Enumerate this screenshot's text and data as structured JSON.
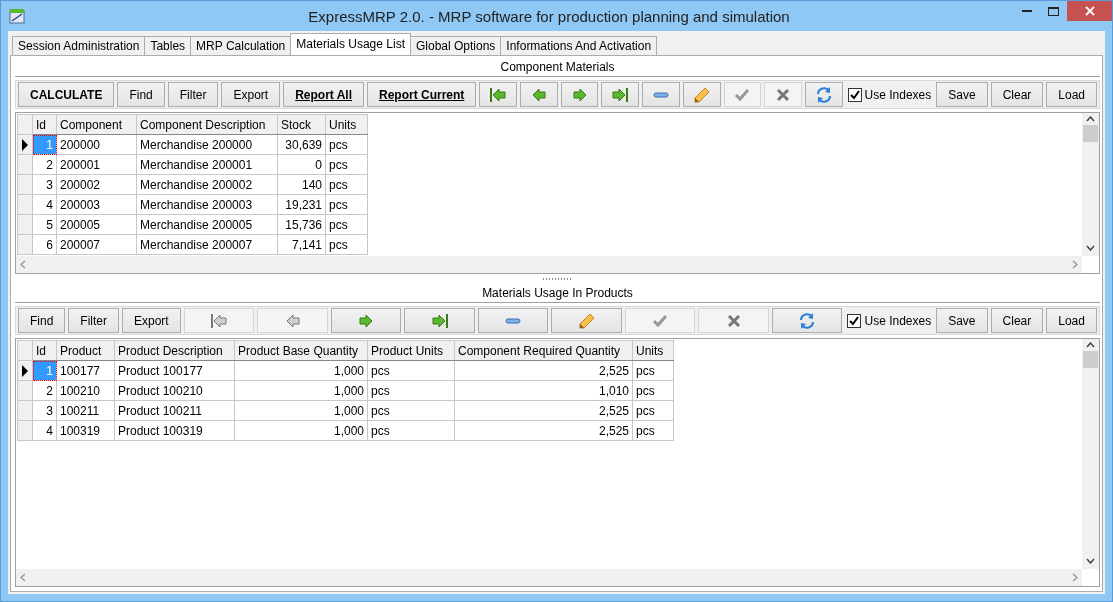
{
  "window": {
    "title": "ExpressMRP 2.0. - MRP software for production planning and simulation"
  },
  "tabs": [
    {
      "label": "Session Administration",
      "selected": false
    },
    {
      "label": "Tables",
      "selected": false
    },
    {
      "label": "MRP Calculation",
      "selected": false
    },
    {
      "label": "Materials Usage List",
      "selected": true
    },
    {
      "label": "Global Options",
      "selected": false
    },
    {
      "label": "Informations And Activation",
      "selected": false
    }
  ],
  "panels": [
    {
      "caption": "Component Materials",
      "toolbar": [
        {
          "kind": "strong",
          "label": "CALCULATE"
        },
        {
          "kind": "button",
          "label": "Find"
        },
        {
          "kind": "button",
          "label": "Filter"
        },
        {
          "kind": "button",
          "label": "Export"
        },
        {
          "kind": "link",
          "label": "Report All"
        },
        {
          "kind": "link",
          "label": "Report Current"
        },
        {
          "kind": "first",
          "disabled": false
        },
        {
          "kind": "prev",
          "disabled": false
        },
        {
          "kind": "next",
          "disabled": false
        },
        {
          "kind": "last",
          "disabled": false
        },
        {
          "kind": "delete",
          "disabled": false
        },
        {
          "kind": "edit",
          "disabled": false
        },
        {
          "kind": "post",
          "disabled": true
        },
        {
          "kind": "cancel",
          "disabled": true
        },
        {
          "kind": "refresh",
          "disabled": false
        },
        {
          "kind": "checkbox",
          "label": "Use Indexes",
          "checked": true
        },
        {
          "kind": "button",
          "label": "Save"
        },
        {
          "kind": "button",
          "label": "Clear"
        },
        {
          "kind": "button",
          "label": "Load"
        }
      ],
      "columns": [
        {
          "label": "Id",
          "numeric": true
        },
        {
          "label": "Component",
          "numeric": false
        },
        {
          "label": "Component Description",
          "numeric": false
        },
        {
          "label": "Stock",
          "numeric": true
        },
        {
          "label": "Units",
          "numeric": false
        }
      ],
      "rows": [
        {
          "selected": true,
          "cells": [
            "1",
            "200000",
            "Merchandise 200000",
            "30,639",
            "pcs"
          ]
        },
        {
          "selected": false,
          "cells": [
            "2",
            "200001",
            "Merchandise 200001",
            "0",
            "pcs"
          ]
        },
        {
          "selected": false,
          "cells": [
            "3",
            "200002",
            "Merchandise 200002",
            "140",
            "pcs"
          ]
        },
        {
          "selected": false,
          "cells": [
            "4",
            "200003",
            "Merchandise 200003",
            "19,231",
            "pcs"
          ]
        },
        {
          "selected": false,
          "cells": [
            "5",
            "200005",
            "Merchandise 200005",
            "15,736",
            "pcs"
          ]
        },
        {
          "selected": false,
          "cells": [
            "6",
            "200007",
            "Merchandise 200007",
            "7,141",
            "pcs"
          ]
        }
      ]
    },
    {
      "caption": "Materials Usage In Products",
      "toolbar": [
        {
          "kind": "button",
          "label": "Find"
        },
        {
          "kind": "button",
          "label": "Filter"
        },
        {
          "kind": "button",
          "label": "Export"
        },
        {
          "kind": "first",
          "disabled": true
        },
        {
          "kind": "prev",
          "disabled": true
        },
        {
          "kind": "next",
          "disabled": false
        },
        {
          "kind": "last",
          "disabled": false
        },
        {
          "kind": "delete",
          "disabled": false
        },
        {
          "kind": "edit",
          "disabled": false
        },
        {
          "kind": "post",
          "disabled": true
        },
        {
          "kind": "cancel",
          "disabled": true
        },
        {
          "kind": "refresh",
          "disabled": false
        },
        {
          "kind": "checkbox",
          "label": "Use Indexes",
          "checked": true
        },
        {
          "kind": "button",
          "label": "Save"
        },
        {
          "kind": "button",
          "label": "Clear"
        },
        {
          "kind": "button",
          "label": "Load"
        }
      ],
      "columns": [
        {
          "label": "Id",
          "numeric": true
        },
        {
          "label": "Product",
          "numeric": false
        },
        {
          "label": "Product Description",
          "numeric": false
        },
        {
          "label": "Product Base Quantity",
          "numeric": true
        },
        {
          "label": "Product Units",
          "numeric": false
        },
        {
          "label": "Component Required Quantity",
          "numeric": true
        },
        {
          "label": "Units",
          "numeric": false
        }
      ],
      "rows": [
        {
          "selected": true,
          "cells": [
            "1",
            "100177",
            "Product 100177",
            "1,000",
            "pcs",
            "2,525",
            "pcs"
          ]
        },
        {
          "selected": false,
          "cells": [
            "2",
            "100210",
            "Product 100210",
            "1,000",
            "pcs",
            "1,010",
            "pcs"
          ]
        },
        {
          "selected": false,
          "cells": [
            "3",
            "100211",
            "Product 100211",
            "1,000",
            "pcs",
            "2,525",
            "pcs"
          ]
        },
        {
          "selected": false,
          "cells": [
            "4",
            "100319",
            "Product 100319",
            "1,000",
            "pcs",
            "2,525",
            "pcs"
          ]
        }
      ]
    }
  ]
}
